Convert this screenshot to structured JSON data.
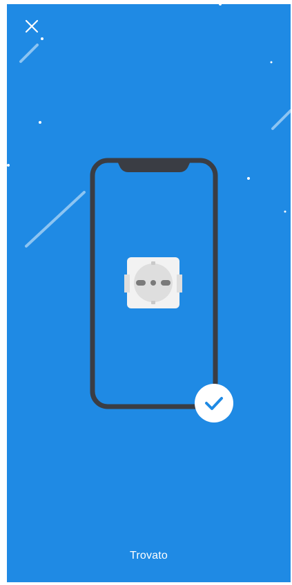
{
  "screen": {
    "background_color": "#1f8ae4",
    "status_text": "Trovato"
  },
  "close_button": {
    "icon": "close-icon",
    "color": "#ffffff"
  },
  "illustration": {
    "phone_frame_color": "#3a3d44",
    "socket_icon": "power-socket-icon",
    "badge_icon": "checkmark-icon",
    "badge_check_color": "#1f8ae4"
  }
}
